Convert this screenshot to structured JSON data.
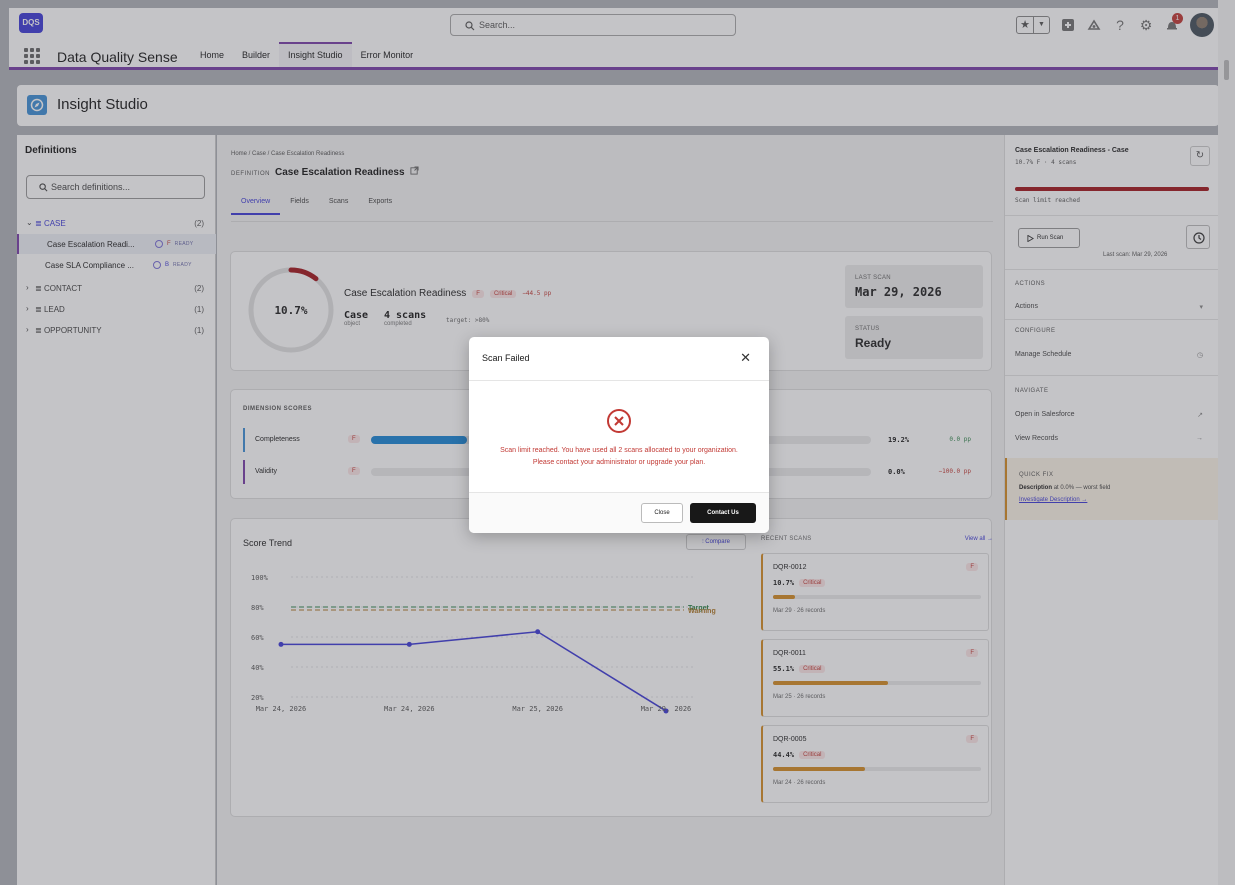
{
  "app": {
    "logo_text": "DQS",
    "name": "Data Quality Sense",
    "search_placeholder": "Search...",
    "notification_count": "1",
    "nav_tabs": [
      "Home",
      "Builder",
      "Insight Studio",
      "Error Monitor"
    ],
    "active_tab_index": 2,
    "accent_color": "#7a3fa8",
    "brand_color": "#3f3cd8"
  },
  "page": {
    "title": "Insight Studio"
  },
  "sidebar": {
    "title": "Definitions",
    "search_placeholder": "Search definitions...",
    "groups": [
      {
        "label": "CASE",
        "count": "(2)",
        "expanded": true
      },
      {
        "label": "CONTACT",
        "count": "(2)",
        "expanded": false
      },
      {
        "label": "LEAD",
        "count": "(1)",
        "expanded": false
      },
      {
        "label": "OPPORTUNITY",
        "count": "(1)",
        "expanded": false
      }
    ],
    "case_items": [
      {
        "label": "Case Escalation Readi...",
        "grade": "F",
        "status": "READY",
        "active": true
      },
      {
        "label": "Case SLA Compliance ...",
        "grade": "B",
        "status": "READY",
        "active": false
      }
    ]
  },
  "main": {
    "breadcrumb": "Home / Case / Case Escalation Readiness",
    "definition_label": "DEFINITION",
    "definition_name": "Case Escalation Readiness",
    "tabs": [
      "Overview",
      "Fields",
      "Scans",
      "Exports"
    ],
    "hero": {
      "score_text": "10.7%",
      "score_fraction": 0.107,
      "name": "Case Escalation Readiness",
      "grade": "F",
      "severity": "Critical",
      "delta": "−44.5 pp",
      "object": "Case",
      "object_label": "object",
      "scans": "4 scans",
      "scans_label": "completed",
      "target": "target: >80%",
      "last_scan_label": "LAST SCAN",
      "last_scan": "Mar 29, 2026",
      "status_label": "STATUS",
      "status": "Ready"
    },
    "dimensions": {
      "title": "DIMENSION SCORES",
      "rows": [
        {
          "name": "Completeness",
          "grade": "F",
          "score": "19.2%",
          "fraction": 0.192,
          "delta": "0.0 pp",
          "delta_color": "#2e844a"
        },
        {
          "name": "Validity",
          "grade": "F",
          "score": "0.0%",
          "fraction": 0.0,
          "delta": "−100.0 pp",
          "delta_color": "#c23934"
        }
      ]
    },
    "trend": {
      "title": "Score Trend",
      "compare_label": "Compare",
      "target_label": "Target",
      "warning_label": "Warning"
    },
    "recent_scans": {
      "title": "RECENT SCANS",
      "view_all": "View all →",
      "items": [
        {
          "id": "DQR-0012",
          "grade": "F",
          "score": "10.7%",
          "fraction": 0.107,
          "severity": "Critical",
          "meta": "Mar 29 · 26 records"
        },
        {
          "id": "DQR-0011",
          "grade": "F",
          "score": "55.1%",
          "fraction": 0.551,
          "severity": "Critical",
          "meta": "Mar 25 · 26 records"
        },
        {
          "id": "DQR-0005",
          "grade": "F",
          "score": "44.4%",
          "fraction": 0.444,
          "severity": "Critical",
          "meta": "Mar 24 · 26 records"
        }
      ]
    }
  },
  "chart_data": {
    "type": "line",
    "title": "Score Trend",
    "x": [
      "Mar 24, 2026",
      "Mar 24, 2026",
      "Mar 25, 2026",
      "Mar 29, 2026"
    ],
    "series": [
      {
        "values": [
          55.1,
          55.1,
          63.5,
          10.7
        ],
        "color": "#3f3cd8"
      }
    ],
    "yticks": [
      "100%",
      "80%",
      "60%",
      "40%",
      "20%"
    ],
    "ylim": [
      20,
      100
    ],
    "reference_lines": [
      {
        "label": "Target",
        "value": 80,
        "color": "#2e844a"
      },
      {
        "label": "Warning",
        "value": 78,
        "color": "#b07a2a"
      }
    ],
    "grid": true
  },
  "right_panel": {
    "title": "Case Escalation Readiness - Case",
    "subtitle": "10.7% F · 4 scans",
    "limit_text": "Scan limit reached",
    "run_scan": "Run Scan",
    "last_scan": "Last scan: Mar 29, 2026",
    "actions_header": "ACTIONS",
    "actions_item": "Actions",
    "configure_header": "CONFIGURE",
    "manage_schedule": "Manage Schedule",
    "navigate_header": "NAVIGATE",
    "open_salesforce": "Open in Salesforce",
    "view_records": "View Records",
    "quick_fix_header": "QUICK FIX",
    "quick_fix_field": "Description",
    "quick_fix_detail": "at 0.0% — worst field",
    "quick_fix_link": "Investigate Description →"
  },
  "modal": {
    "title": "Scan Failed",
    "message": "Scan limit reached. You have used all 2 scans allocated to your organization. Please contact your administrator or upgrade your plan.",
    "close_label": "Close",
    "contact_label": "Contact Us"
  }
}
